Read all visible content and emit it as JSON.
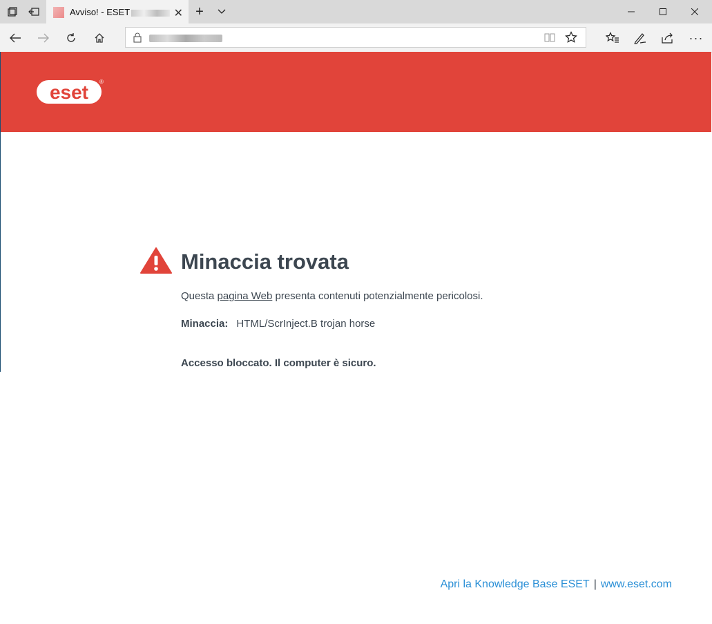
{
  "browser": {
    "tab_title": "Avviso! - ESET",
    "address_url": ""
  },
  "page": {
    "heading": "Minaccia trovata",
    "desc_prefix": "Questa ",
    "desc_link": "pagina Web",
    "desc_suffix": " presenta contenuti potenzialmente pericolosi.",
    "threat_label": "Minaccia:",
    "threat_value": "HTML/ScrInject.B trojan horse",
    "access_message": "Accesso bloccato. Il computer è sicuro.",
    "footer_kb_link": "Apri la Knowledge Base ESET",
    "footer_separator": "|",
    "footer_site_link": "www.eset.com"
  },
  "logo": {
    "text": "eset",
    "registered": "®"
  },
  "colors": {
    "banner": "#e1443a",
    "heading_text": "#3c4650",
    "link_blue": "#2a8fd6",
    "warning_red": "#e1443a"
  }
}
